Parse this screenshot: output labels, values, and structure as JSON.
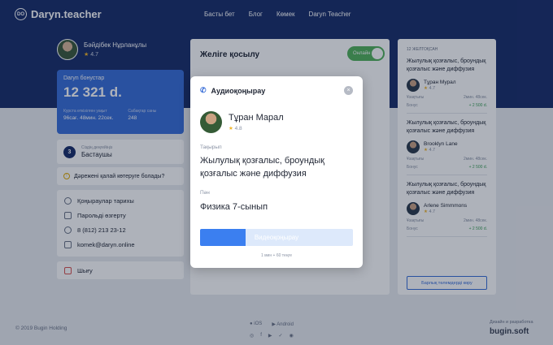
{
  "header": {
    "logo_mark": "DO",
    "logo_text": "Daryn.teacher",
    "nav": [
      "Басты бет",
      "Блог",
      "Көмек",
      "Daryn Teacher"
    ]
  },
  "profile": {
    "name": "Бәйдібек Нұрланұлы",
    "rating": "4.7"
  },
  "bonus": {
    "title": "Daryn бонустар",
    "value": "12 321 d.",
    "time_label": "Курста өткізілген уақыт",
    "time_value": "96сағ. 48мин. 22сек.",
    "lessons_label": "Сабақтар саны",
    "lessons_value": "248"
  },
  "level": {
    "num": "3",
    "label": "Сіздің деңгейіңіз",
    "value": "Бастаушы"
  },
  "howto": "Дәрежені қалай көтеруге болады?",
  "menu": [
    "Қоңыраулар тарихы",
    "Парольді өзгерту",
    "8 (812) 213 23-12",
    "komek@daryn.online"
  ],
  "logout": "Шығу",
  "center": {
    "title": "Желіге қосылу",
    "toggle_label": "Онлайн"
  },
  "right": {
    "header": "12 ЖЕЛТОҚСАН",
    "items": [
      {
        "subject": "Жылулық қозғалыс, броундық қозғалыс және диффузия",
        "name": "Тұран Мурал",
        "rating": "4.7",
        "duration_label": "Ұзақтығы",
        "duration": "2мин. 48сек.",
        "bonus_label": "Бонус",
        "bonus": "+ 2 500 d."
      },
      {
        "subject": "Жылулық қозғалыс, броундық қозғалыс және диффузия",
        "name": "Brooklyn Lane",
        "rating": "4.7",
        "duration_label": "Ұзақтығы",
        "duration": "2мин. 48сек.",
        "bonus_label": "Бонус",
        "bonus": "+ 2 500 d."
      },
      {
        "subject": "Жылулық қозғалыс, броундық қозғалыс және диффузия",
        "name": "Arlene Simmmons",
        "rating": "4.7",
        "duration_label": "Ұзақтығы",
        "duration": "2мин. 48сек.",
        "bonus_label": "Бонус",
        "bonus": "+ 2 500 d."
      }
    ],
    "button": "Барлық төлемдерді көру"
  },
  "footer": {
    "copyright": "© 2019 Bugin Holding",
    "stores": [
      "iOS",
      "Android"
    ],
    "design_label": "Дизайн и разработка",
    "brand": "bugin.soft"
  },
  "modal": {
    "title": "Аудиоқоңырау",
    "tutor_name": "Тұран Марал",
    "tutor_rating": "4.8",
    "topic_label": "Тақырып",
    "topic": "Жылулық қозғалыс, броундық қозғалыс және диффузия",
    "subject_label": "Пән",
    "subject": "Физика 7-сынып",
    "button": "Видеоқоңырау",
    "progress": 0.3,
    "timer": "1 мин + 60 теңге"
  }
}
